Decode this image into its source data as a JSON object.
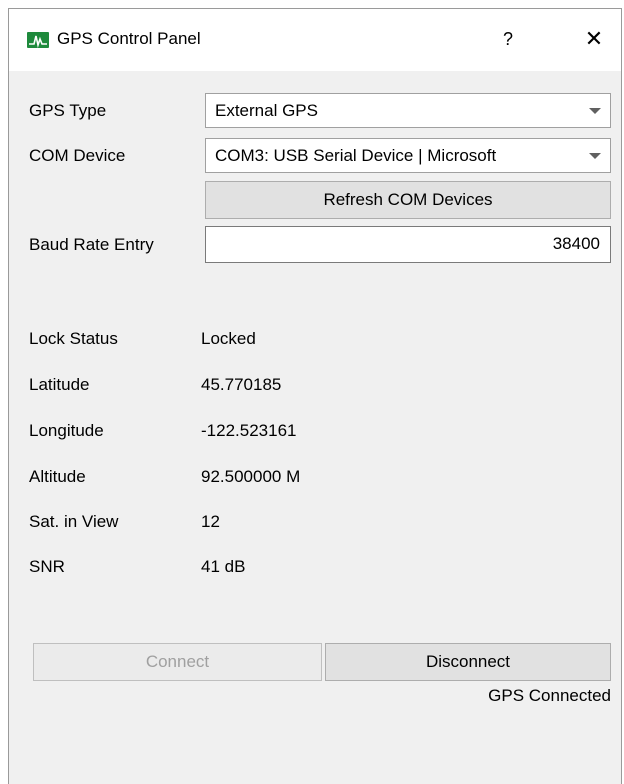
{
  "window": {
    "title": "GPS Control Panel",
    "help_label": "?",
    "close_label": "✕",
    "icon": "waveform-app-icon"
  },
  "config": {
    "gps_type_label": "GPS Type",
    "gps_type_value": "External GPS",
    "com_device_label": "COM Device",
    "com_device_value": "COM3: USB Serial Device | Microsoft",
    "refresh_button": "Refresh COM Devices",
    "baud_label": "Baud Rate Entry",
    "baud_value": "38400"
  },
  "status": [
    {
      "label": "Lock Status",
      "value": "Locked"
    },
    {
      "label": "Latitude",
      "value": "45.770185"
    },
    {
      "label": "Longitude",
      "value": "-122.523161"
    },
    {
      "label": "Altitude",
      "value": "92.500000 M"
    },
    {
      "label": "Sat. in View",
      "value": "12"
    },
    {
      "label": "SNR",
      "value": "41 dB"
    }
  ],
  "actions": {
    "connect_label": "Connect",
    "disconnect_label": "Disconnect",
    "connection_status": "GPS Connected"
  },
  "colors": {
    "icon_green": "#1e8a3c",
    "disabled_text": "#a0a0a0"
  }
}
